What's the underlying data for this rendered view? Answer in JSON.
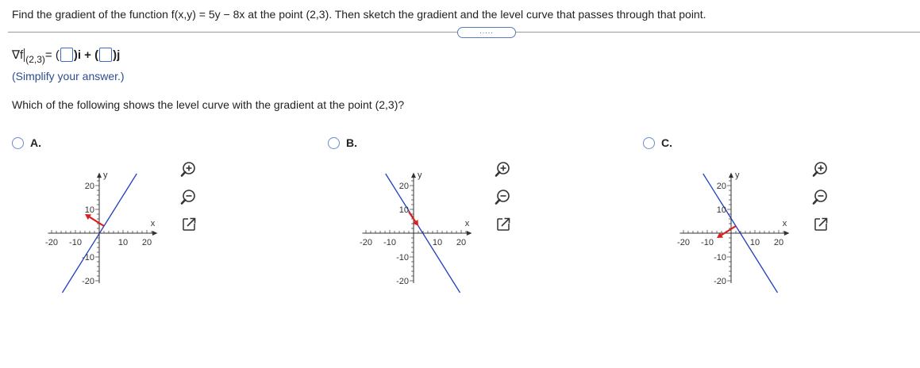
{
  "question": "Find the gradient of the function f(x,y) = 5y − 8x at the point (2,3). Then sketch the gradient and the level curve that passes through that point.",
  "more_button_label": ".....",
  "answer": {
    "nabla_f": "∇f",
    "subscript": "(2,3)",
    "equals": "= (",
    "i_part": ")i + (",
    "j_part": ")j"
  },
  "hint": "(Simplify your answer.)",
  "mc_question": "Which of the following shows the level curve with the gradient at the point (2,3)?",
  "colors": {
    "level_curve": "#1f3fbf",
    "gradient_vector": "#d92020",
    "link_blue": "#2c4d8f"
  },
  "options": [
    {
      "label": "A.",
      "graph": {
        "x_label": "x",
        "y_label": "y",
        "x_ticks": [
          "-20",
          "-10",
          "10",
          "20"
        ],
        "y_ticks": [
          "20",
          "10",
          "-10",
          "-20"
        ],
        "x_range": [
          -25,
          25
        ],
        "y_range": [
          -25,
          25
        ],
        "level_curve": {
          "slope": 1.6,
          "intercept": -0.2
        },
        "vector": {
          "from": [
            2,
            3
          ],
          "to": [
            -6,
            8
          ]
        }
      }
    },
    {
      "label": "B.",
      "graph": {
        "x_label": "x",
        "y_label": "y",
        "x_ticks": [
          "-20",
          "-10",
          "10",
          "20"
        ],
        "y_ticks": [
          "20",
          "10",
          "-10",
          "-20"
        ],
        "x_range": [
          -25,
          25
        ],
        "y_range": [
          -25,
          25
        ],
        "level_curve": {
          "slope": -1.6,
          "intercept": 6.2
        },
        "vector": {
          "from": [
            -2,
            9
          ],
          "to": [
            2,
            3
          ]
        }
      }
    },
    {
      "label": "C.",
      "graph": {
        "x_label": "x",
        "y_label": "y",
        "x_ticks": [
          "-20",
          "-10",
          "10",
          "20"
        ],
        "y_ticks": [
          "20",
          "10",
          "-10",
          "-20"
        ],
        "x_range": [
          -25,
          25
        ],
        "y_range": [
          -25,
          25
        ],
        "level_curve": {
          "slope": -1.6,
          "intercept": 6.2
        },
        "vector": {
          "from": [
            2,
            3
          ],
          "to": [
            -6,
            -2
          ]
        }
      }
    }
  ],
  "tool_icons": [
    "zoom-in-icon",
    "zoom-out-icon",
    "expand-icon"
  ]
}
